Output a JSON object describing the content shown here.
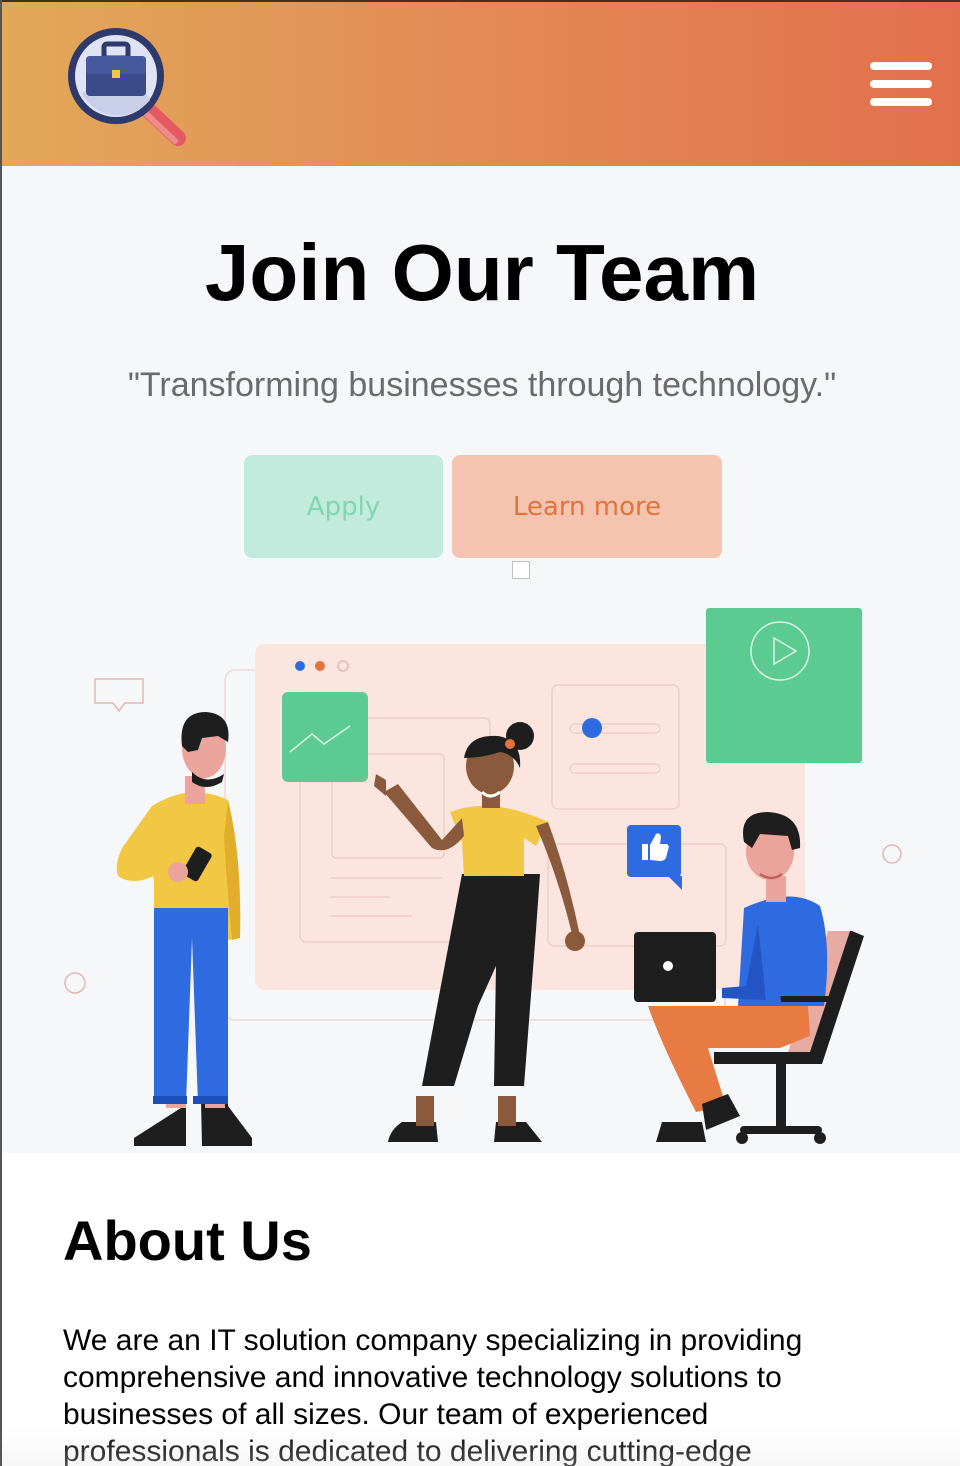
{
  "header": {
    "logo_icon": "briefcase-magnifier-icon",
    "menu_icon": "hamburger-menu-icon",
    "colors": {
      "gradient_start": "#e2a85a",
      "gradient_end": "#e3704c"
    }
  },
  "hero": {
    "title": "Join Our Team",
    "tagline": "\"Transforming businesses through technology.\"",
    "apply_label": "Apply",
    "learn_more_label": "Learn more",
    "illustration": "team-collaboration-illustration",
    "colors": {
      "apply_bg": "#c2ebde",
      "apply_text": "#7fd6b1",
      "learn_bg": "#f5c4b0",
      "learn_text": "#e2733c"
    }
  },
  "about": {
    "title": "About Us",
    "text": "We are an IT solution company specializing in providing comprehensive and innovative technology solutions to businesses of all sizes. Our team of experienced professionals is dedicated to delivering cutting-edge"
  }
}
